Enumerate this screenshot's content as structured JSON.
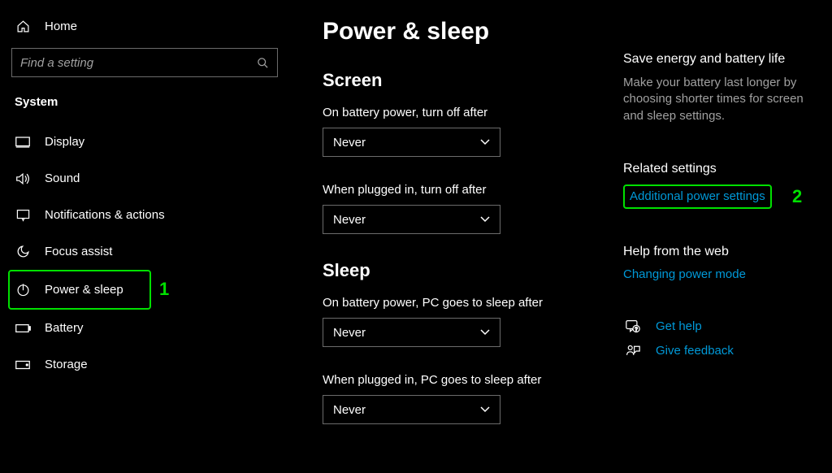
{
  "sidebar": {
    "home": "Home",
    "search_placeholder": "Find a setting",
    "section": "System",
    "items": [
      {
        "label": "Display"
      },
      {
        "label": "Sound"
      },
      {
        "label": "Notifications & actions"
      },
      {
        "label": "Focus assist"
      },
      {
        "label": "Power & sleep"
      },
      {
        "label": "Battery"
      },
      {
        "label": "Storage"
      }
    ]
  },
  "page": {
    "title": "Power & sleep",
    "screen": {
      "heading": "Screen",
      "battery_label": "On battery power, turn off after",
      "battery_value": "Never",
      "plugged_label": "When plugged in, turn off after",
      "plugged_value": "Never"
    },
    "sleep": {
      "heading": "Sleep",
      "battery_label": "On battery power, PC goes to sleep after",
      "battery_value": "Never",
      "plugged_label": "When plugged in, PC goes to sleep after",
      "plugged_value": "Never"
    }
  },
  "side": {
    "energy_title": "Save energy and battery life",
    "energy_desc": "Make your battery last longer by choosing shorter times for screen and sleep settings.",
    "related_title": "Related settings",
    "related_link": "Additional power settings",
    "help_title": "Help from the web",
    "help_link": "Changing power mode",
    "get_help": "Get help",
    "give_feedback": "Give feedback"
  },
  "annotations": {
    "one": "1",
    "two": "2"
  }
}
